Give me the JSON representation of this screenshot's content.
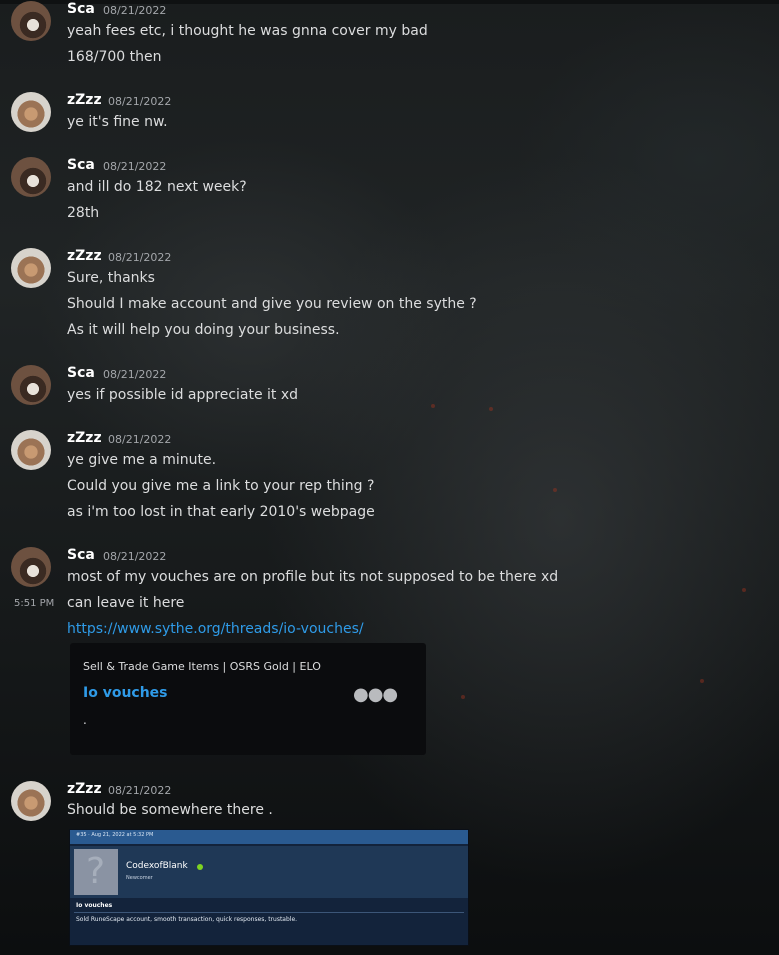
{
  "groups": [
    {
      "author": "Sca",
      "date": "08/21/2022",
      "lines": [
        "yeah fees etc, i thought he was gnna cover my bad",
        "168/700 then"
      ]
    },
    {
      "author": "zZzz",
      "date": "08/21/2022",
      "lines": [
        "ye it's fine nw."
      ]
    },
    {
      "author": "Sca",
      "date": "08/21/2022",
      "lines": [
        "and ill do 182 next week?",
        "28th"
      ]
    },
    {
      "author": "zZzz",
      "date": "08/21/2022",
      "lines": [
        "Sure, thanks",
        "Should I make account and give you review on the sythe ?",
        "As it will help you doing your business."
      ]
    },
    {
      "author": "Sca",
      "date": "08/21/2022",
      "lines": [
        "yes if possible id appreciate it xd"
      ]
    },
    {
      "author": "zZzz",
      "date": "08/21/2022",
      "lines": [
        "ye give me a minute.",
        "Could you give me a link to your rep thing ?",
        "as i'm too lost in that early 2010's webpage"
      ]
    },
    {
      "author": "Sca",
      "date": "08/21/2022",
      "lines": [
        "most of my vouches are on profile but its not supposed to be there xd",
        "can leave it here"
      ],
      "side_time": "5:51 PM",
      "link": "https://www.sythe.org/threads/io-vouches/",
      "embed": {
        "provider": "Sell & Trade Game Items | OSRS Gold | ELO",
        "title": "Io vouches",
        "description": ".",
        "more_icon": "ellipsis-icon"
      }
    },
    {
      "author": "zZzz",
      "date": "08/21/2022",
      "lines": [
        "Should be somewhere there ."
      ],
      "attachment": {
        "header": "#35 · Aug 21, 2022 at 5:32 PM",
        "username": "CodexofBlank",
        "rank": "Newcomer",
        "online_color": "#7ed321",
        "thread_title": "Io vouches",
        "body": "Sold RuneScape account, smooth transaction, quick responses, trustable."
      }
    }
  ]
}
